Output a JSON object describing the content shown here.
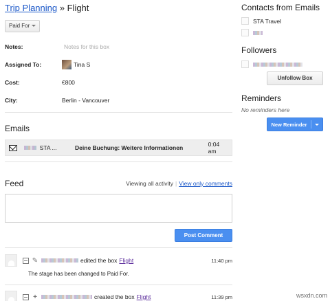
{
  "breadcrumb": {
    "parent": "Trip Planning",
    "separator": "»",
    "current": "Flight"
  },
  "stage": {
    "label": "Paid For"
  },
  "fields": {
    "notes": {
      "label": "Notes:",
      "placeholder": "Notes for this box"
    },
    "assigned": {
      "label": "Assigned To:",
      "value": "Tina S"
    },
    "cost": {
      "label": "Cost:",
      "value": "€800"
    },
    "city": {
      "label": "City:",
      "value": "Berlin - Vancouver"
    }
  },
  "emails": {
    "title": "Emails",
    "items": [
      {
        "sender": "STA ...",
        "subject": "Deine Buchung: Weitere Informationen",
        "time": "0:04 am"
      }
    ]
  },
  "feed": {
    "title": "Feed",
    "viewing": "Viewing all activity",
    "separator": "|",
    "only_comments": "View only comments",
    "post_button": "Post Comment",
    "activities": [
      {
        "action": "edited the box",
        "link": "Flight",
        "time": "11:40 pm",
        "detail": "The stage has been changed to Paid For."
      },
      {
        "action": "created the box",
        "link": "Flight",
        "time": "11:39 pm"
      }
    ]
  },
  "sidebar": {
    "contacts": {
      "title": "Contacts from Emails",
      "items": [
        "STA Travel"
      ]
    },
    "followers": {
      "title": "Followers",
      "unfollow": "Unfollow Box"
    },
    "reminders": {
      "title": "Reminders",
      "empty": "No reminders here",
      "new_button": "New Reminder"
    }
  },
  "watermark": "wsxdn.com",
  "colors": {
    "link": "#1a57c8",
    "primary_button": "#4a8ff0",
    "visited_link": "#5a2b9b"
  }
}
